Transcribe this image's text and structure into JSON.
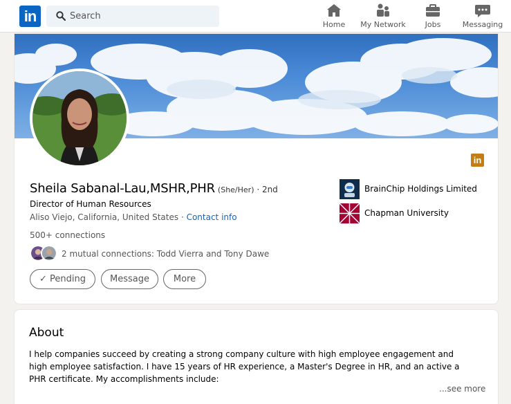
{
  "nav": {
    "logo_text": "in",
    "search_placeholder": "Search",
    "items": [
      {
        "label": "Home",
        "icon": "home-icon"
      },
      {
        "label": "My Network",
        "icon": "network-icon"
      },
      {
        "label": "Jobs",
        "icon": "briefcase-icon"
      },
      {
        "label": "Messaging",
        "icon": "messaging-icon"
      }
    ]
  },
  "profile": {
    "name": "Sheila Sabanal-Lau,MSHR,PHR",
    "pronouns": "(She/Her)",
    "degree": " · 2nd",
    "headline": "Director of Human Resources",
    "location": "Aliso Viejo, California, United States",
    "location_separator": " · ",
    "contact_info": "Contact info",
    "connections": "500+ connections",
    "mutual": "2 mutual connections: Todd Vierra and Tony Dawe",
    "buttons": {
      "pending": "Pending",
      "message": "Message",
      "more": "More"
    },
    "badge_text": "in",
    "orgs": [
      {
        "name": "BrainChip Holdings Limited",
        "icon": "brainchip-logo"
      },
      {
        "name": "Chapman University",
        "icon": "chapman-logo"
      }
    ]
  },
  "about": {
    "title": "About",
    "text": "I help companies succeed by creating a strong company culture with high employee engagement and high employee satisfaction. I have 15 years of HR experience, a Master's Degree in HR, and an active a PHR certificate. My accomplishments include:",
    "see_more": "...see more"
  },
  "colors": {
    "brand": "#0a66c2",
    "page_bg": "#f3f2ef",
    "badge": "#c37d16",
    "chapman": "#a50034"
  }
}
